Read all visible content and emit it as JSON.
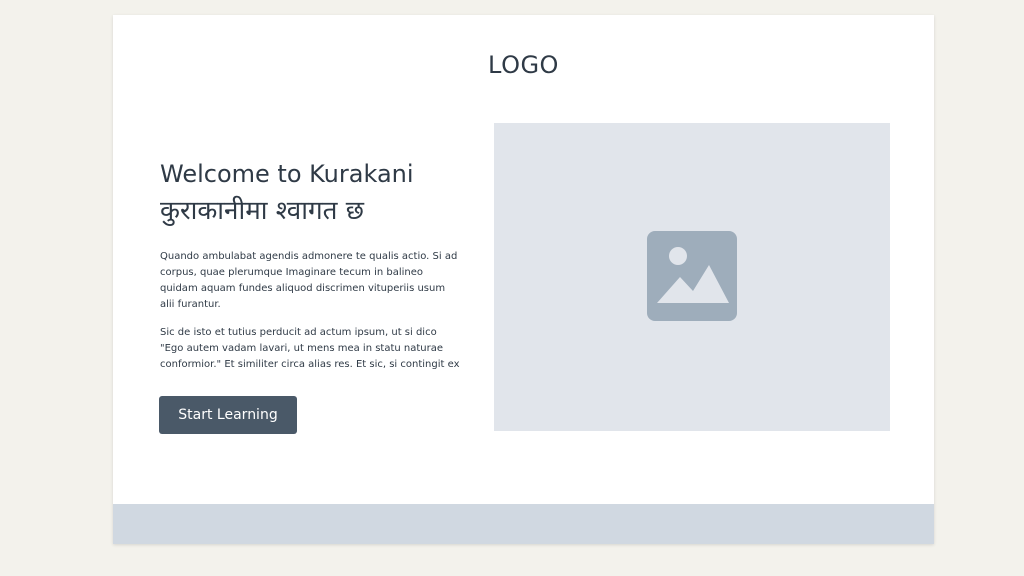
{
  "header": {
    "logo_text": "LOGO"
  },
  "hero": {
    "title": "Welcome to Kurakani",
    "title_nepali": "कुराकानीमा श्वागत छ",
    "paragraphs": [
      "Quando ambulabat agendis admonere te qualis actio. Si ad corpus, quae plerumque Imaginare tecum in balineo quidam aquam fundes aliquod discrimen vituperiis usum alii furantur.",
      "Sic de isto et tutius perducit ad actum ipsum, ut si dico \"Ego autem vadam lavari, ut mens mea in statu naturae conformior.\" Et similiter circa alias res. Et sic, si contingit ex"
    ],
    "cta_label": "Start Learning"
  },
  "media": {
    "icon": "image-placeholder-icon"
  },
  "colors": {
    "background": "#f3f2ec",
    "card": "#ffffff",
    "text": "#2f3a46",
    "button": "#4a5968",
    "placeholder": "#e1e5eb",
    "placeholder_icon": "#9eadbb",
    "footer": "#d0d8e1"
  }
}
